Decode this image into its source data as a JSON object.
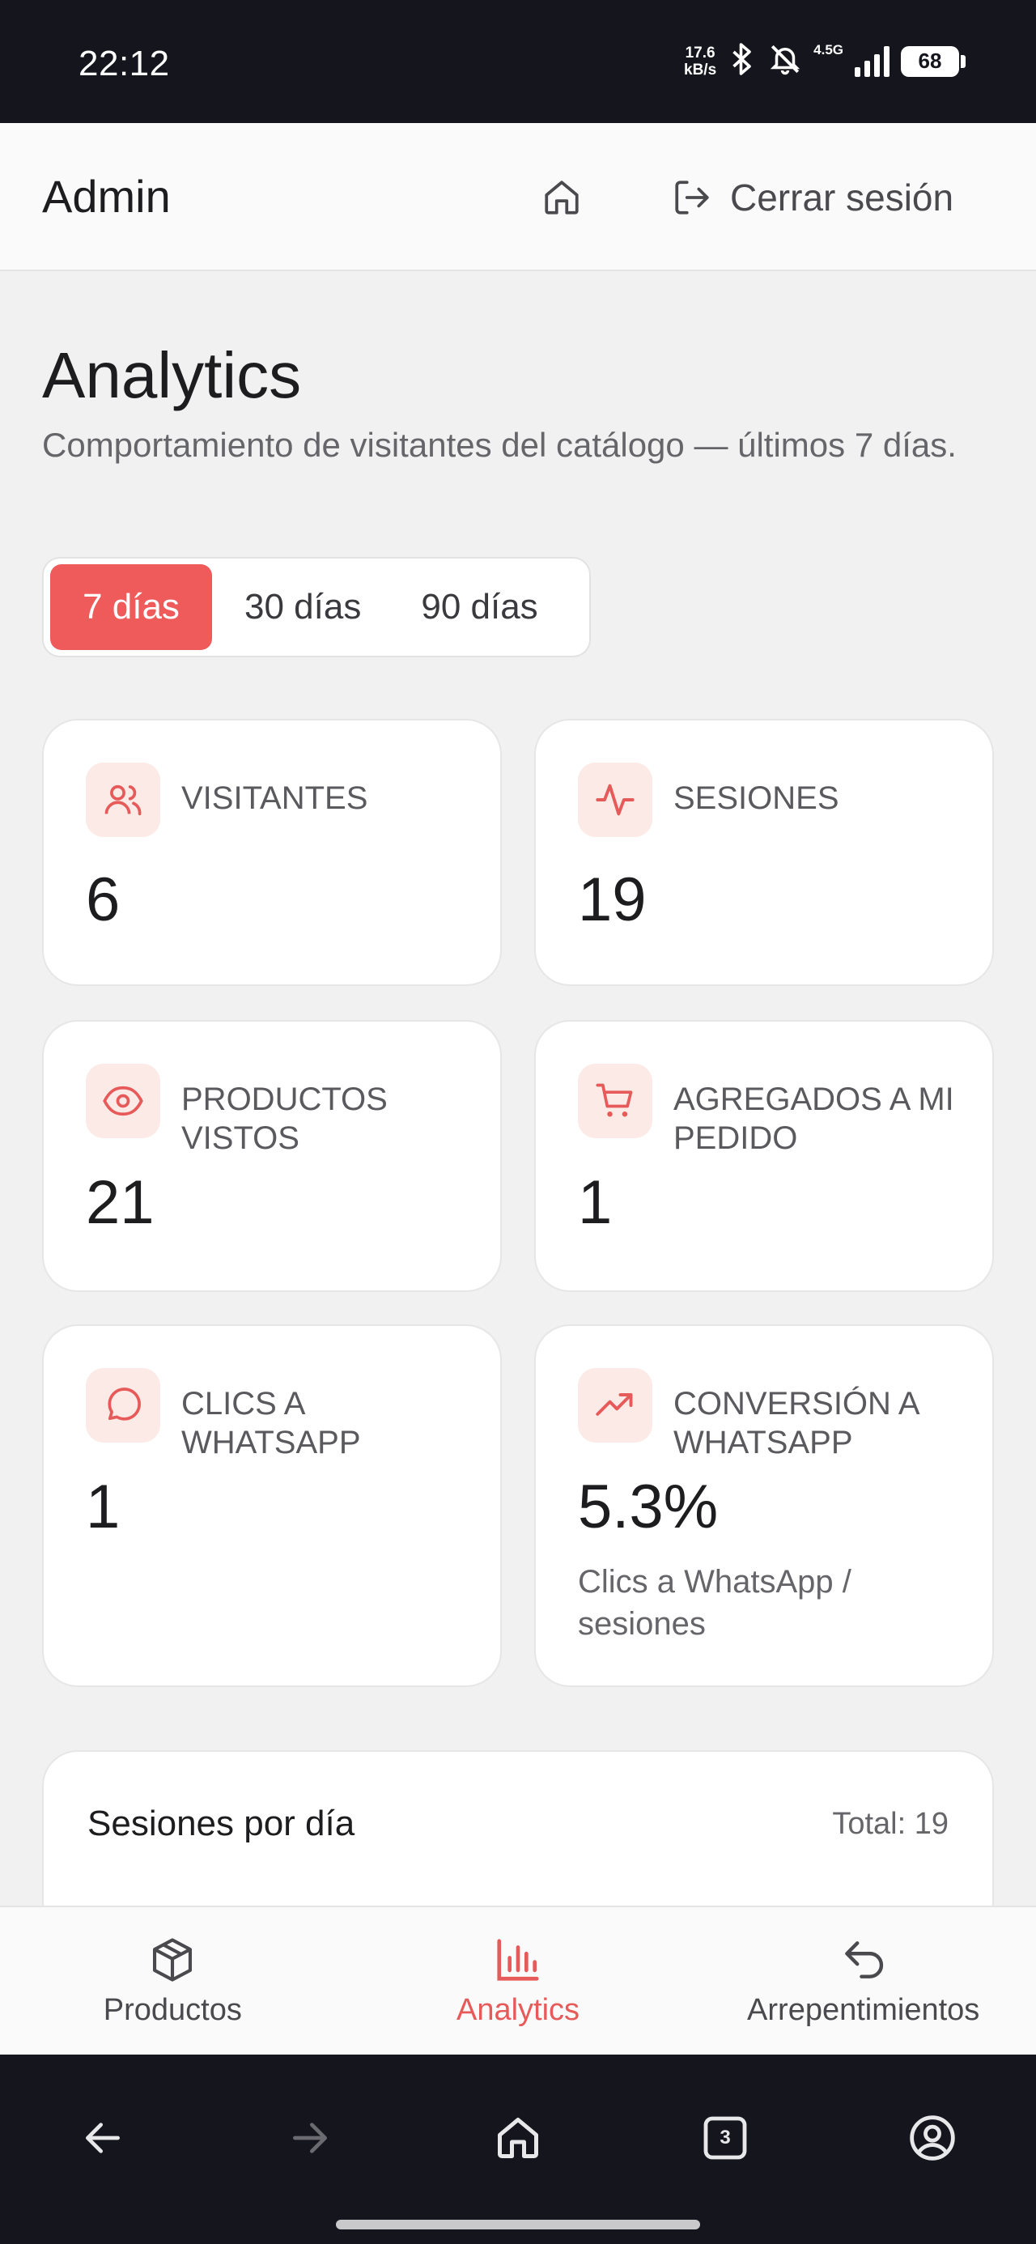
{
  "status_bar": {
    "time": "22:12",
    "net_speed_value": "17.6",
    "net_speed_unit": "kB/s",
    "signal_label": "4.5G",
    "battery": "68"
  },
  "header": {
    "title": "Admin",
    "logout_label": "Cerrar sesión"
  },
  "page": {
    "title": "Analytics",
    "subtitle": "Comportamiento de visitantes del catálogo — últimos 7 días."
  },
  "range_selector": {
    "options": [
      "7 días",
      "30 días",
      "90 días"
    ],
    "selected": "7 días"
  },
  "stats": [
    {
      "label": "Visitantes",
      "value": "6",
      "icon": "users-icon"
    },
    {
      "label": "Sesiones",
      "value": "19",
      "icon": "activity-icon"
    },
    {
      "label": "Productos vistos",
      "value": "21",
      "icon": "eye-icon"
    },
    {
      "label": "Agregados a mi pedido",
      "value": "1",
      "icon": "cart-icon"
    },
    {
      "label": "Clics a WhatsApp",
      "value": "1",
      "icon": "message-icon"
    },
    {
      "label": "Conversión a WhatsApp",
      "value": "5.3%",
      "icon": "trending-up-icon",
      "note": "Clics a WhatsApp / sesiones"
    }
  ],
  "sessions_chart": {
    "title": "Sesiones por día",
    "total": "Total: 19"
  },
  "bottom_nav": {
    "items": [
      {
        "label": "Productos",
        "icon": "package-icon",
        "active": false
      },
      {
        "label": "Analytics",
        "icon": "bar-chart-icon",
        "active": true
      },
      {
        "label": "Arrepentimientos",
        "icon": "undo-icon",
        "active": false
      }
    ]
  },
  "system_nav": {
    "tab_count": "3"
  },
  "colors": {
    "accent": "#ef5b5b",
    "icon_bg": "#fbeae6",
    "status_bar": "#15151d"
  }
}
